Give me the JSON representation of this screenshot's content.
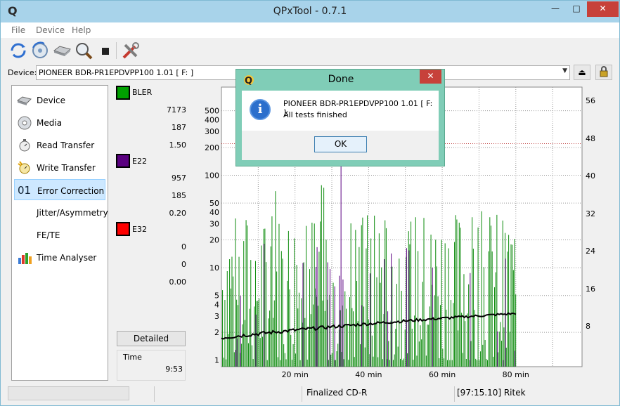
{
  "window": {
    "title": "QPxTool - 0.7.1",
    "app_icon_letter": "Q",
    "min": "—",
    "max": "□",
    "close": "✕"
  },
  "menu": {
    "file": "File",
    "device": "Device",
    "help": "Help"
  },
  "toolbar": {
    "icons": [
      "refresh-icon",
      "rescan-icon",
      "drive-icon",
      "search-icon",
      "stop-icon",
      "tools-icon"
    ]
  },
  "device": {
    "label": "Device:",
    "value": "PIONEER  BDR-PR1EPDVPP100 1.01 [ F: ]"
  },
  "nav": [
    {
      "label": "Device",
      "icon": "drive-icon"
    },
    {
      "label": "Media",
      "icon": "disc-icon"
    },
    {
      "label": "Read Transfer",
      "icon": "stopwatch-icon"
    },
    {
      "label": "Write Transfer",
      "icon": "stopwatch-write-icon"
    },
    {
      "label": "Error Correction",
      "icon": "01",
      "selected": true
    },
    {
      "label": "Jitter/Asymmetry",
      "icon": ""
    },
    {
      "label": "FE/TE",
      "icon": ""
    },
    {
      "label": "Time Analyser",
      "icon": "bars-icon"
    }
  ],
  "stats": {
    "bler": {
      "label": "BLER",
      "color": "#00a000",
      "total": "7173",
      "max": "187",
      "avg": "1.50"
    },
    "e22": {
      "label": "E22",
      "color": "#5a0080",
      "total": "957",
      "max": "185",
      "avg": "0.20"
    },
    "e32": {
      "label": "E32",
      "color": "#ff0000",
      "total": "0",
      "max": "0",
      "avg": "0.00"
    }
  },
  "detailed_label": "Detailed",
  "time": {
    "label": "Time",
    "value": "9:53"
  },
  "chart_data": {
    "type": "bar",
    "y_left_ticks": [
      "1",
      "2",
      "3",
      "4",
      "5",
      "10",
      "20",
      "30",
      "40",
      "50",
      "100",
      "200",
      "300",
      "400",
      "500"
    ],
    "y_left_values": [
      1,
      2,
      3,
      4,
      5,
      10,
      20,
      30,
      40,
      50,
      100,
      200,
      300,
      400,
      500
    ],
    "y_right_ticks": [
      "8",
      "16",
      "24",
      "32",
      "40",
      "48",
      "56"
    ],
    "x_ticks": [
      "20 min",
      "40 min",
      "60 min",
      "80 min"
    ],
    "x_values": [
      20,
      40,
      60,
      80
    ],
    "x_max_min": 80,
    "y_scale": "log",
    "grid": true
  },
  "status": {
    "left": "",
    "media": "Finalized CD-R",
    "atip": "[97:15.10] Ritek"
  },
  "dialog": {
    "title": "Done",
    "close": "✕",
    "message_line1": "PIONEER  BDR-PR1EPDVPP100 1.01 [ F: ]:",
    "message_line2": "All tests finished",
    "ok": "OK",
    "info_glyph": "i"
  }
}
